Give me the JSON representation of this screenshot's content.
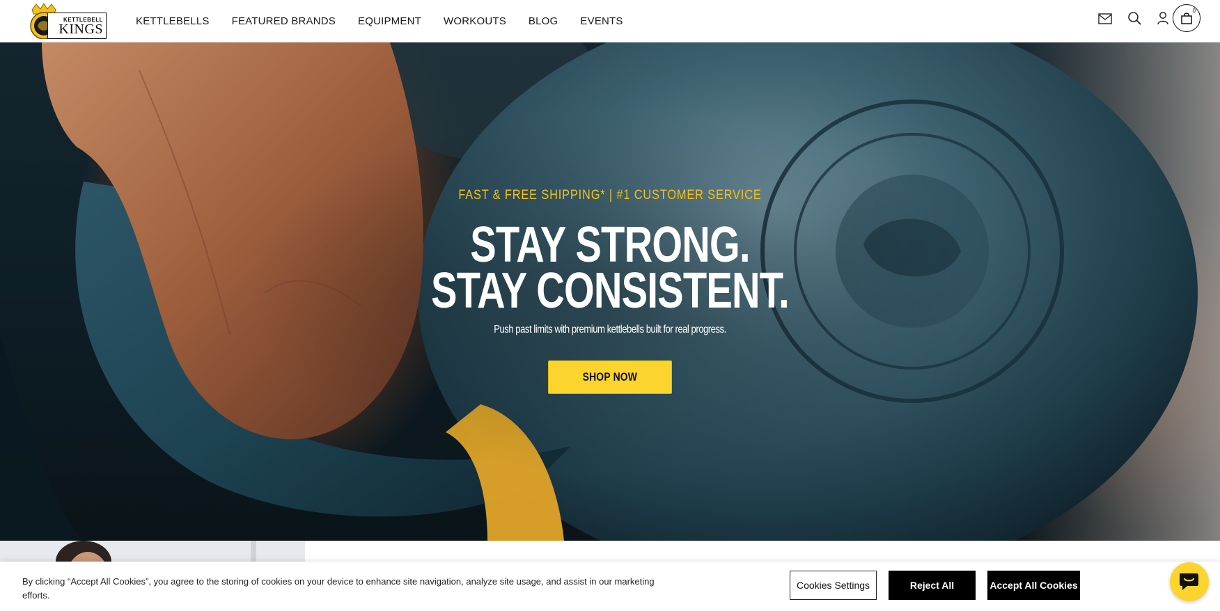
{
  "brand": {
    "logo_top": "KETTLEBELL",
    "logo_main": "KINGS"
  },
  "nav": {
    "items": [
      {
        "label": "KETTLEBELLS"
      },
      {
        "label": "FEATURED BRANDS"
      },
      {
        "label": "EQUIPMENT"
      },
      {
        "label": "WORKOUTS"
      },
      {
        "label": "BLOG"
      },
      {
        "label": "EVENTS"
      }
    ]
  },
  "header_icons": {
    "mail": "mail-icon",
    "search": "search-icon",
    "account": "user-icon",
    "cart": "shopping-bag-icon",
    "cart_count": "0"
  },
  "hero": {
    "eyebrow": "FAST & FREE SHIPPING* | #1 CUSTOMER SERVICE",
    "title_line1": "STAY STRONG.",
    "title_line2": "STAY CONSISTENT.",
    "subtitle": "Push past limits with premium kettlebells built for real progress.",
    "cta_label": "SHOP NOW"
  },
  "cookie": {
    "text": "By clicking “Accept All Cookies”, you agree to the storing of cookies on your device to enhance site navigation, analyze site usage, and assist in our marketing efforts.",
    "settings_label": "Cookies Settings",
    "reject_label": "Reject All",
    "accept_label": "Accept All Cookies"
  },
  "chat": {
    "icon": "chat-bubble-icon"
  },
  "colors": {
    "accent_yellow": "#fcd42e",
    "eyebrow_yellow": "#f2c21b",
    "black": "#000000",
    "white": "#ffffff"
  }
}
